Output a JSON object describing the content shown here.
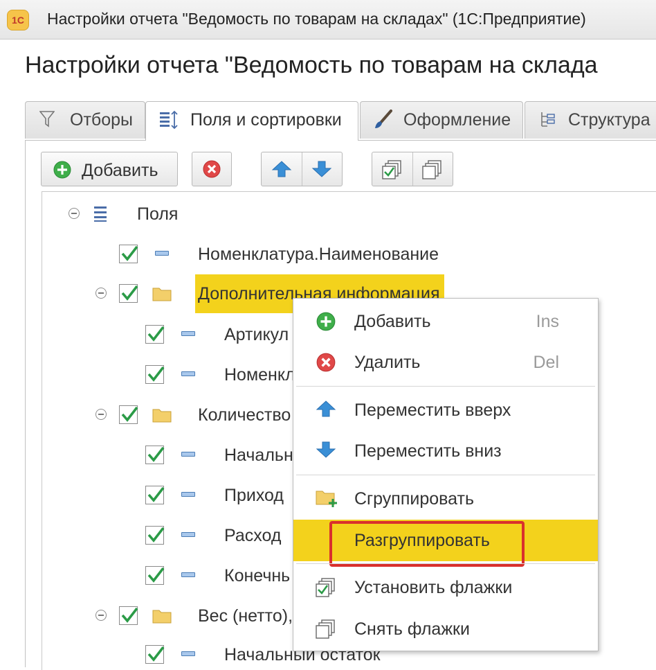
{
  "window": {
    "app_logo": "1С",
    "title": "Настройки отчета \"Ведомость по товарам на складах\"  (1С:Предприятие)"
  },
  "page": {
    "heading": "Настройки отчета \"Ведомость по товарам на склада"
  },
  "tabs": [
    {
      "label": "Отборы",
      "icon": "filter-icon",
      "active": false
    },
    {
      "label": "Поля и сортировки",
      "icon": "fields-sort-icon",
      "active": true
    },
    {
      "label": "Оформление",
      "icon": "brush-icon",
      "active": false
    },
    {
      "label": "Структура",
      "icon": "structure-icon",
      "active": false
    }
  ],
  "toolbar": {
    "add_label": "Добавить",
    "icons": [
      "plus-circle-icon",
      "delete-icon",
      "arrow-up-icon",
      "arrow-down-icon",
      "check-all-icon",
      "uncheck-all-icon"
    ]
  },
  "tree": {
    "root_label": "Поля",
    "rows": [
      {
        "label": "Номенклатура.Наименование",
        "checked": true,
        "type": "field"
      },
      {
        "label": "Дополнительная информация",
        "checked": true,
        "type": "group",
        "selected": true
      },
      {
        "label": "Артикул",
        "checked": true,
        "type": "field"
      },
      {
        "label": "Номенкл",
        "checked": true,
        "type": "field"
      },
      {
        "label": "Количество",
        "checked": true,
        "type": "group"
      },
      {
        "label": "Начальн",
        "checked": true,
        "type": "field"
      },
      {
        "label": "Приход",
        "checked": true,
        "type": "field"
      },
      {
        "label": "Расход",
        "checked": true,
        "type": "field"
      },
      {
        "label": "Конечнь",
        "checked": true,
        "type": "field"
      },
      {
        "label": "Вес (нетто),",
        "checked": true,
        "type": "group"
      },
      {
        "label": "Начальный остаток",
        "checked": true,
        "type": "field"
      }
    ]
  },
  "context_menu": {
    "items": [
      {
        "label": "Добавить",
        "shortcut": "Ins",
        "icon": "plus-circle-icon"
      },
      {
        "label": "Удалить",
        "shortcut": "Del",
        "icon": "delete-icon"
      },
      {
        "label": "Переместить вверх",
        "shortcut": "",
        "icon": "arrow-up-icon"
      },
      {
        "label": "Переместить вниз",
        "shortcut": "",
        "icon": "arrow-down-icon"
      },
      {
        "label": "Сгруппировать",
        "shortcut": "",
        "icon": "folder-add-icon"
      },
      {
        "label": "Разгруппировать",
        "shortcut": "",
        "icon": "ungroup-icon",
        "highlighted": true
      },
      {
        "label": "Установить флажки",
        "shortcut": "",
        "icon": "check-all-icon"
      },
      {
        "label": "Снять флажки",
        "shortcut": "",
        "icon": "uncheck-all-icon"
      }
    ]
  },
  "colors": {
    "highlight": "#f3d21c",
    "annotation_frame": "#d9302c",
    "check": "#2b9b47",
    "accent_blue": "#3a8fd6"
  }
}
